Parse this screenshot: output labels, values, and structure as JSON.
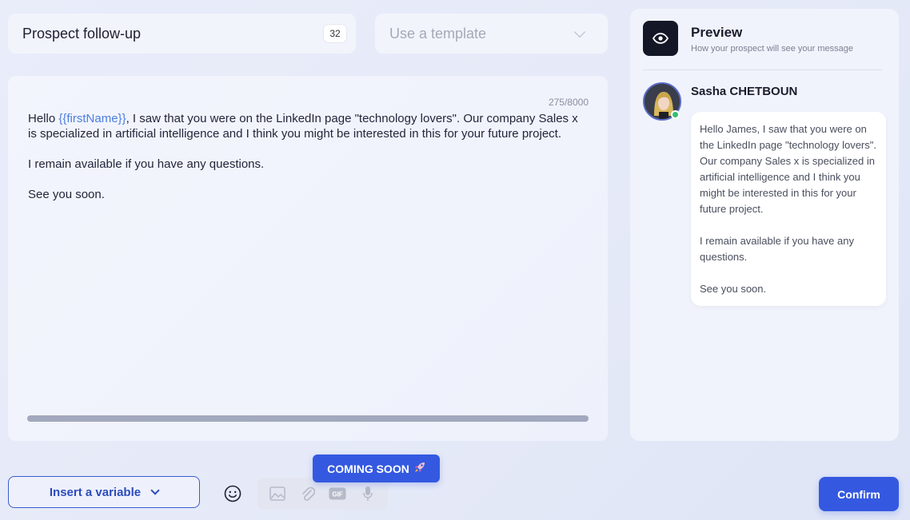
{
  "header": {
    "title_value": "Prospect follow-up",
    "title_char_badge": "32",
    "template_placeholder": "Use a template"
  },
  "editor": {
    "char_count": "275/8000",
    "greeting": "Hello ",
    "variable": "{{firstName}}",
    "paragraph1_rest": ", I saw that you were on the LinkedIn page \"technology lovers\". Our company Sales x is specialized in artificial intelligence and I think you might be interested in this for your future project.",
    "paragraph2": "I remain available if you have any questions.",
    "paragraph3": "See you soon."
  },
  "preview": {
    "title": "Preview",
    "subtitle": "How your prospect will see your message",
    "sender_name": "Sasha CHETBOUN",
    "message_paragraph1": "Hello James, I saw that you were on the LinkedIn page \"technology lovers\". Our company Sales x is specialized in artificial intelligence and I think you might be interested in this for your future project.",
    "message_paragraph2": "I remain available if you have any questions.",
    "message_paragraph3": "See you soon."
  },
  "toolbar": {
    "insert_variable_label": "Insert a variable",
    "coming_soon_label": "COMING SOON",
    "confirm_label": "Confirm",
    "icons": [
      "emoji-icon",
      "image-icon",
      "attachment-icon",
      "gif-icon",
      "microphone-icon",
      "rocket-icon",
      "eye-icon",
      "chevron-down-icon"
    ]
  },
  "colors": {
    "accent": "#3459e0",
    "variable": "#4b7ee0",
    "online": "#2fbf71",
    "dark_tile": "#141726"
  }
}
